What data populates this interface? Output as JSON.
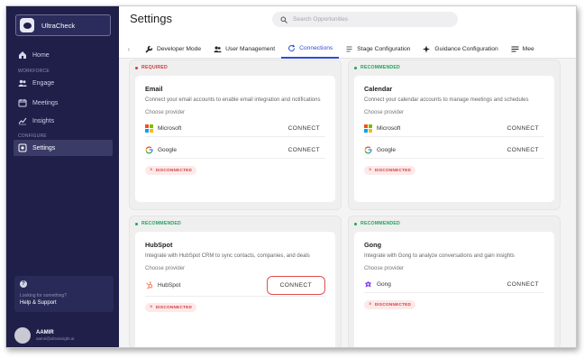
{
  "app": {
    "name": "UltraCheck"
  },
  "sidebar": {
    "items": [
      {
        "label": "Home",
        "icon": "home-icon"
      },
      {
        "label": "Engage",
        "icon": "users-icon"
      },
      {
        "label": "Meetings",
        "icon": "calendar-icon"
      },
      {
        "label": "Insights",
        "icon": "chart-icon"
      },
      {
        "label": "Settings",
        "icon": "gear-icon",
        "active": true
      }
    ],
    "sections": {
      "workforce": "WORKFORCE",
      "configure": "CONFIGURE"
    },
    "help": {
      "subtitle": "Looking for something?",
      "title": "Help & Support"
    },
    "user": {
      "name": "AAMIR",
      "email": "aamir@ultrainsight.ai"
    }
  },
  "header": {
    "title": "Settings",
    "search_placeholder": "Search Opportunities"
  },
  "tabs": [
    {
      "label": "Developer Mode",
      "icon": "wrench-icon"
    },
    {
      "label": "User Management",
      "icon": "users-icon"
    },
    {
      "label": "Connections",
      "icon": "refresh-icon",
      "active": true
    },
    {
      "label": "Stage Configuration",
      "icon": "document-icon"
    },
    {
      "label": "Guidance Configuration",
      "icon": "sparkle-icon"
    },
    {
      "label": "Mee",
      "icon": "menu-icon"
    }
  ],
  "cards": {
    "email": {
      "tag": "REQUIRED",
      "title": "Email",
      "desc": "Connect your email accounts to enable email integration and notifications",
      "choose": "Choose provider",
      "providers": [
        {
          "name": "Microsoft",
          "action": "CONNECT"
        },
        {
          "name": "Google",
          "action": "CONNECT"
        }
      ],
      "status": "DISCONNECTED"
    },
    "calendar": {
      "tag": "RECOMMENDED",
      "title": "Calendar",
      "desc": "Connect your calendar accounts to manage meetings and schedules",
      "choose": "Choose provider",
      "providers": [
        {
          "name": "Microsoft",
          "action": "CONNECT"
        },
        {
          "name": "Google",
          "action": "CONNECT"
        }
      ],
      "status": "DISCONNECTED"
    },
    "hubspot": {
      "tag": "RECOMMENDED",
      "title": "HubSpot",
      "desc": "Integrate with HubSpot CRM to sync contacts, companies, and deals",
      "choose": "Choose provider",
      "providers": [
        {
          "name": "HubSpot",
          "action": "CONNECT"
        }
      ],
      "status": "DISCONNECTED"
    },
    "gong": {
      "tag": "RECOMMENDED",
      "title": "Gong",
      "desc": "Integrate with Gong to analyze conversations and gain insights",
      "choose": "Choose provider",
      "providers": [
        {
          "name": "Gong",
          "action": "CONNECT"
        }
      ],
      "status": "DISCONNECTED"
    }
  },
  "colors": {
    "sidebar": "#1f1f4a",
    "accent": "#2f4bd6",
    "required": "#d23a3a",
    "recommended": "#21a35a"
  }
}
